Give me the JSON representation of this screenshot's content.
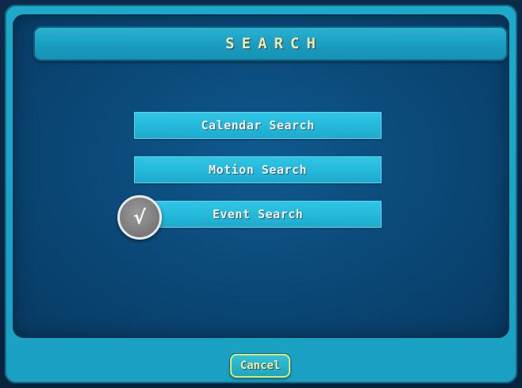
{
  "header": {
    "title": "SEARCH"
  },
  "menu": {
    "items": [
      {
        "label": "Calendar Search"
      },
      {
        "label": "Motion Search"
      },
      {
        "label": "Event Search"
      }
    ],
    "selected_marker": "√"
  },
  "footer": {
    "cancel_label": "Cancel"
  },
  "colors": {
    "frame": "#1fa9c9",
    "panel": "#0b4a7a",
    "button": "#22b6d8",
    "title_text": "#f2e9a8",
    "button_text": "#f3f4f6"
  },
  "icons": {
    "selection": "checkmark-icon"
  }
}
